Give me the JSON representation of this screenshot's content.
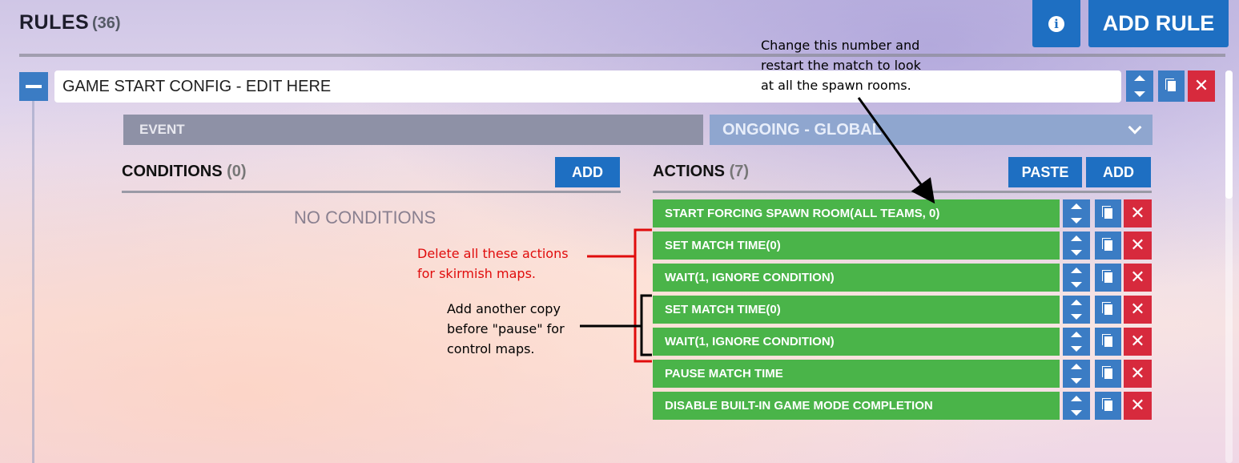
{
  "header": {
    "title": "RULES",
    "count": "(36)",
    "add_rule_label": "ADD RULE",
    "info_icon": "i"
  },
  "rule": {
    "name": "GAME START CONFIG - EDIT HERE",
    "event": {
      "label": "EVENT",
      "value": "ONGOING - GLOBAL"
    },
    "conditions": {
      "title": "CONDITIONS",
      "count": "(0)",
      "add_label": "ADD",
      "empty_text": "NO CONDITIONS"
    },
    "actions": {
      "title": "ACTIONS",
      "count": "(7)",
      "paste_label": "PASTE",
      "add_label": "ADD",
      "items": [
        "START FORCING SPAWN ROOM(ALL TEAMS, 0)",
        "SET MATCH TIME(0)",
        "WAIT(1, IGNORE CONDITION)",
        "SET MATCH TIME(0)",
        "WAIT(1, IGNORE CONDITION)",
        "PAUSE MATCH TIME",
        "DISABLE BUILT-IN GAME MODE COMPLETION"
      ]
    }
  },
  "annotations": {
    "top": [
      "Change this number and",
      "restart the match to look",
      "at all the spawn rooms."
    ],
    "red": [
      "Delete all these actions",
      "for skirmish maps."
    ],
    "black": [
      "Add another copy",
      "before \"pause\" for",
      "control maps."
    ]
  },
  "icons": {
    "collapse": "minus-icon",
    "info": "info-icon",
    "move": "up-down-arrows-icon",
    "copy": "copy-icon",
    "delete": "close-x-icon",
    "dropdown": "chevron-down-icon"
  },
  "colors": {
    "accent_blue": "#1e6fc2",
    "action_green": "#4ab449",
    "delete_red": "#d72a3d",
    "annotation_red": "#e00c0c"
  }
}
